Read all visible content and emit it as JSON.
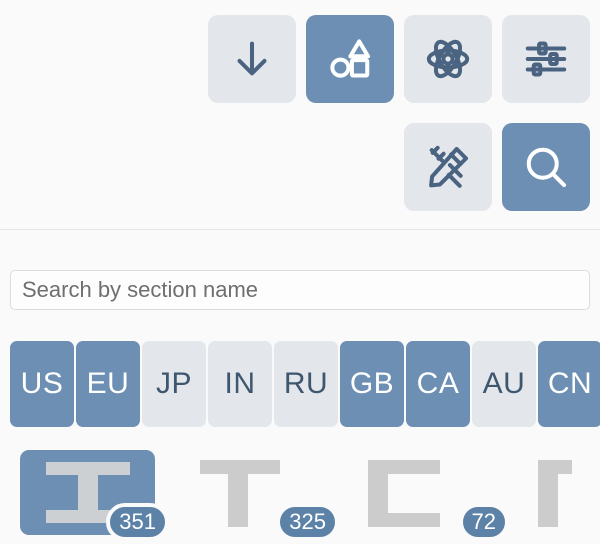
{
  "toolbar": {
    "rows": [
      {
        "buttons": [
          {
            "name": "download-icon",
            "label": "Download",
            "active": false
          },
          {
            "name": "shapes-icon",
            "label": "Shapes",
            "active": true
          },
          {
            "name": "atom-icon",
            "label": "Material",
            "active": false
          },
          {
            "name": "sliders-icon",
            "label": "Settings",
            "active": false
          }
        ]
      },
      {
        "buttons": [
          {
            "name": "design-tools-icon",
            "label": "Design Tools",
            "active": false
          },
          {
            "name": "search-icon",
            "label": "Search",
            "active": true
          }
        ]
      }
    ]
  },
  "search": {
    "placeholder": "Search by section name",
    "value": ""
  },
  "chips": [
    {
      "label": "US",
      "selected": true
    },
    {
      "label": "EU",
      "selected": true
    },
    {
      "label": "JP",
      "selected": false
    },
    {
      "label": "IN",
      "selected": false
    },
    {
      "label": "RU",
      "selected": false
    },
    {
      "label": "GB",
      "selected": true
    },
    {
      "label": "CA",
      "selected": true
    },
    {
      "label": "AU",
      "selected": false
    },
    {
      "label": "CN",
      "selected": true
    }
  ],
  "profiles": [
    {
      "shape": "i-beam-profile-icon",
      "count": "351",
      "selected": true
    },
    {
      "shape": "t-section-profile-icon",
      "count": "325",
      "selected": false
    },
    {
      "shape": "c-channel-profile-icon",
      "count": "72",
      "selected": false
    },
    {
      "shape": "angle-profile-icon",
      "count": "",
      "selected": false
    }
  ],
  "colors": {
    "accent": "#6c8fb3",
    "accent_dark": "#5d82a8",
    "icon": "#4a6381",
    "chip_idle": "#e3e7ec",
    "background": "#fafafa",
    "shape_gray": "#cccccc"
  }
}
